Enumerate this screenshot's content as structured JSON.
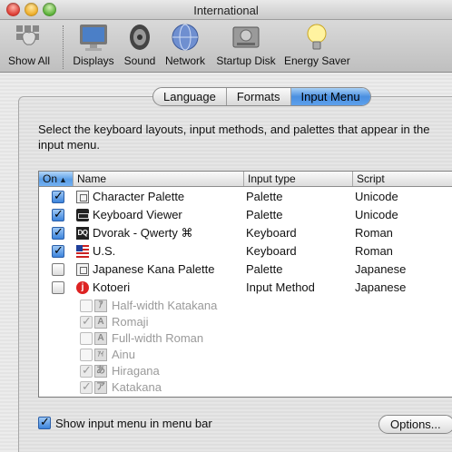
{
  "window": {
    "title": "International"
  },
  "toolbar": {
    "items": [
      {
        "label": "Show All",
        "icon": "apple-icon"
      },
      {
        "label": "Displays",
        "icon": "display-icon"
      },
      {
        "label": "Sound",
        "icon": "speaker-icon"
      },
      {
        "label": "Network",
        "icon": "globe-icon"
      },
      {
        "label": "Startup Disk",
        "icon": "hard-disk-icon"
      },
      {
        "label": "Energy Saver",
        "icon": "lightbulb-icon"
      }
    ]
  },
  "tabs": [
    {
      "label": "Language",
      "active": false
    },
    {
      "label": "Formats",
      "active": false
    },
    {
      "label": "Input Menu",
      "active": true
    }
  ],
  "instructions": "Select the keyboard layouts, input methods, and palettes that appear in the input menu.",
  "table": {
    "headers": {
      "on": "On",
      "name": "Name",
      "type": "Input type",
      "script": "Script"
    },
    "rows": [
      {
        "name": "Character Palette",
        "type": "Palette",
        "script": "Unicode",
        "checked": true,
        "icon": "palette-icon"
      },
      {
        "name": "Keyboard Viewer",
        "type": "Palette",
        "script": "Unicode",
        "checked": true,
        "icon": "keyboard-viewer-icon"
      },
      {
        "name": "Dvorak - Qwerty ⌘",
        "type": "Keyboard",
        "script": "Roman",
        "checked": true,
        "icon": "dvorak-icon",
        "icon_text": "DQ"
      },
      {
        "name": "U.S.",
        "type": "Keyboard",
        "script": "Roman",
        "checked": true,
        "icon": "us-flag-icon"
      },
      {
        "name": "Japanese Kana Palette",
        "type": "Palette",
        "script": "Japanese",
        "checked": false,
        "icon": "palette-icon"
      },
      {
        "name": "Kotoeri",
        "type": "Input Method",
        "script": "Japanese",
        "checked": false,
        "icon": "kotoeri-icon",
        "icon_text": "j"
      }
    ],
    "subrows": [
      {
        "name": "Half-width Katakana",
        "checked": false,
        "icon_text": "ｱ"
      },
      {
        "name": "Romaji",
        "checked": true,
        "icon_text": "A"
      },
      {
        "name": "Full-width Roman",
        "checked": false,
        "icon_text": "A"
      },
      {
        "name": "Ainu",
        "checked": false,
        "icon_text": "ｱｲ"
      },
      {
        "name": "Hiragana",
        "checked": true,
        "icon_text": "あ"
      },
      {
        "name": "Katakana",
        "checked": true,
        "icon_text": "ア"
      }
    ]
  },
  "bottom": {
    "show_menu_label": "Show input menu in menu bar",
    "show_menu_checked": true,
    "options_label": "Options..."
  },
  "colors": {
    "accent": "#4a8fe0",
    "kotoeri_red": "#d22222"
  }
}
